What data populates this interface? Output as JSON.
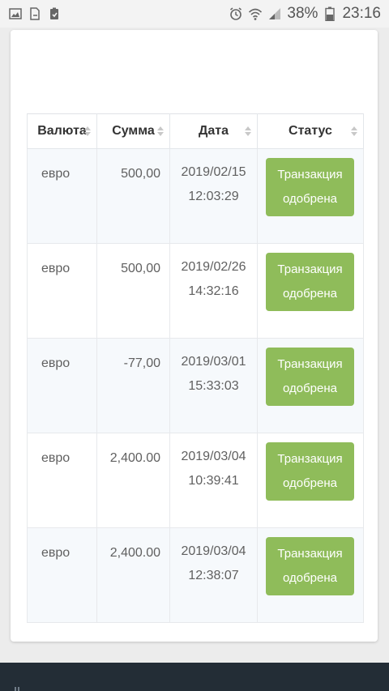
{
  "status_bar": {
    "battery_percent": "38%",
    "time": "23:16",
    "icons": [
      "image-icon",
      "file-icon",
      "clipboard-icon",
      "alarm-icon",
      "wifi-icon",
      "signal-icon",
      "battery-icon"
    ]
  },
  "table": {
    "headers": [
      "Валюта",
      "Сумма",
      "Дата",
      "Статус"
    ],
    "rows": [
      {
        "currency": "евро",
        "amount": "500,00",
        "date": "2019/02/15",
        "time": "12:03:29",
        "status_line1": "Транзакция",
        "status_line2": "одобрена"
      },
      {
        "currency": "евро",
        "amount": "500,00",
        "date": "2019/02/26",
        "time": "14:32:16",
        "status_line1": "Транзакция",
        "status_line2": "одобрена"
      },
      {
        "currency": "евро",
        "amount": "-77,00",
        "date": "2019/03/01",
        "time": "15:33:03",
        "status_line1": "Транзакция",
        "status_line2": "одобрена"
      },
      {
        "currency": "евро",
        "amount": "2,400.00",
        "date": "2019/03/04",
        "time": "10:39:41",
        "status_line1": "Транзакция",
        "status_line2": "одобрена"
      },
      {
        "currency": "евро",
        "amount": "2,400.00",
        "date": "2019/03/04",
        "time": "12:38:07",
        "status_line1": "Транзакция",
        "status_line2": "одобрена"
      }
    ]
  },
  "colors": {
    "status_badge": "#8fbc5a",
    "row_stripe": "#f6f9fc",
    "footer": "#232d36"
  }
}
